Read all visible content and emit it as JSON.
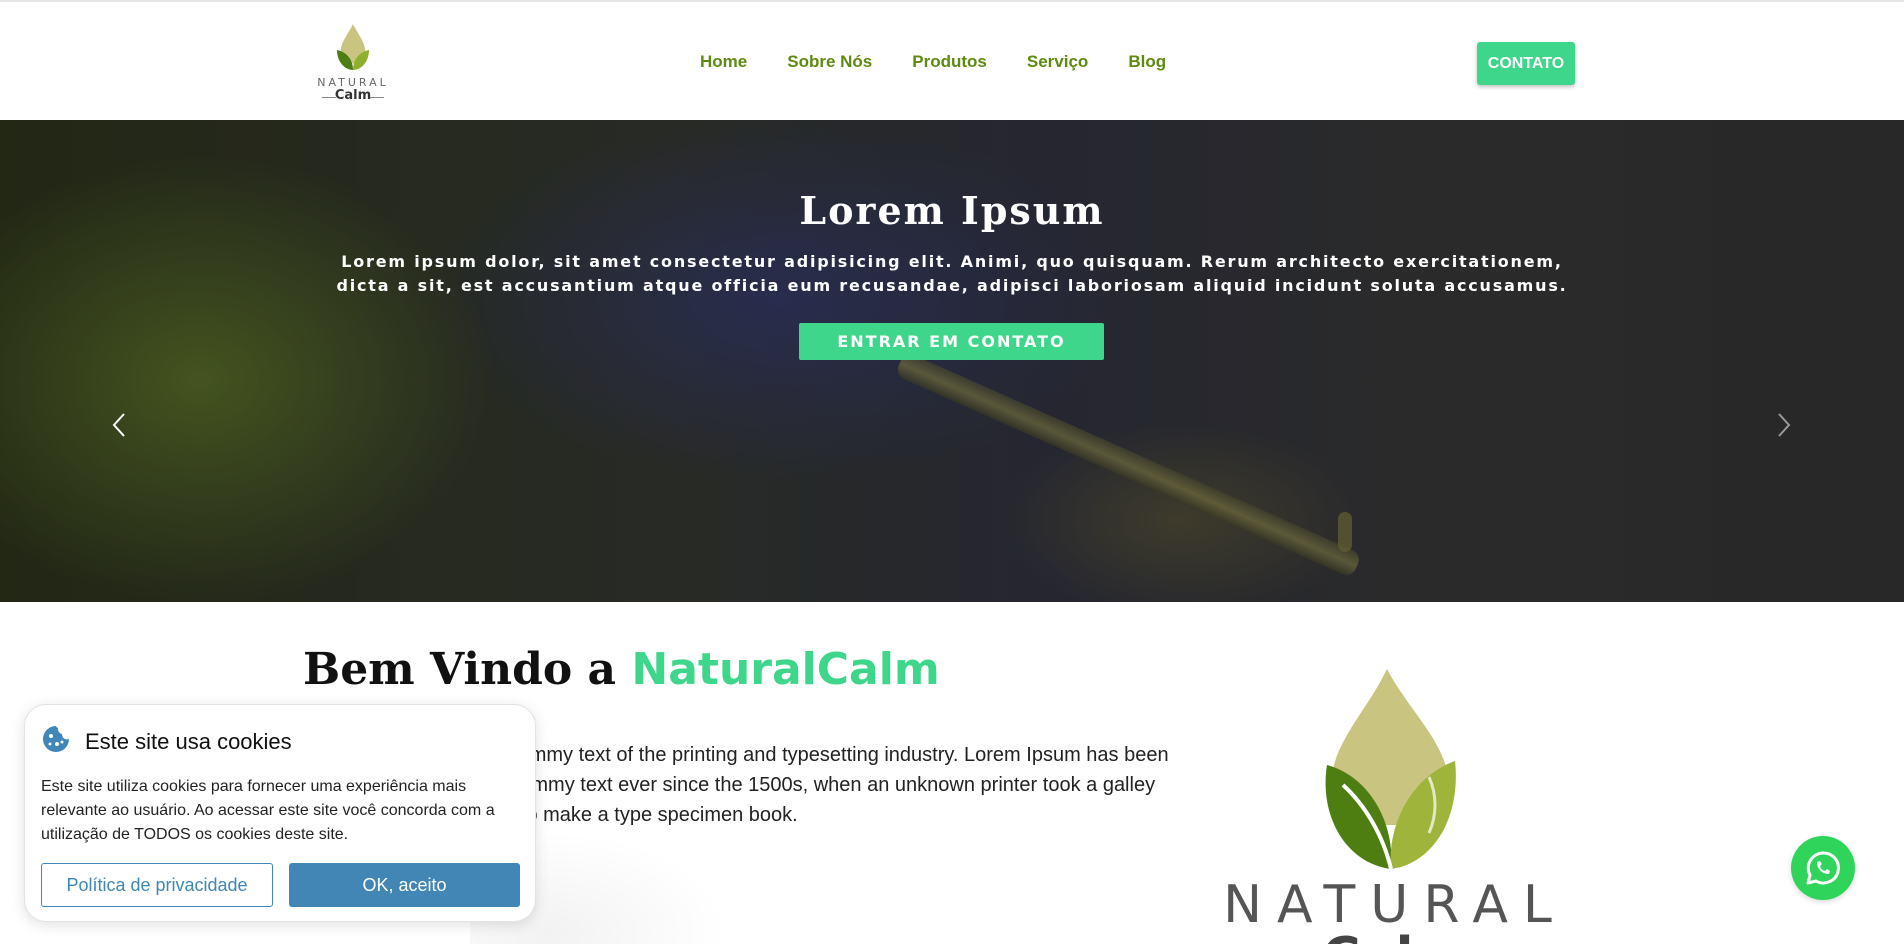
{
  "header": {
    "logo": {
      "word1": "NATURAL",
      "word2": "Calm"
    },
    "nav": [
      {
        "label": "Home"
      },
      {
        "label": "Sobre Nós"
      },
      {
        "label": "Produtos"
      },
      {
        "label": "Serviço"
      },
      {
        "label": "Blog"
      }
    ],
    "contact_button": "CONTATO"
  },
  "hero": {
    "title": "Lorem Ipsum",
    "text_line1": "Lorem ipsum dolor, sit amet consectetur adipisicing elit. Animi, quo quisquam. Rerum architecto exercitationem,",
    "text_line2": "dicta a sit, est accusantium atque officia eum recusandae, adipisci laboriosam aliquid incidunt soluta accusamus.",
    "button": "ENTRAR EM CONTATO",
    "prev_icon": "chevron-left-icon",
    "next_icon": "chevron-right-icon"
  },
  "welcome": {
    "title_prefix": "Bem Vindo a",
    "title_brand": "NaturalCalm",
    "text": "Lorem Ipsum is simply dummy text of the printing and typesetting industry. Lorem Ipsum has been the industry's standard dummy text ever since the 1500s, when an unknown printer took a galley of type and scrambled it to make a type specimen book.",
    "logo_word1": "NATURAL",
    "logo_word2": "Calm"
  },
  "cookie_banner": {
    "icon": "cookie-icon",
    "title": "Este site usa cookies",
    "text": "Este site utiliza cookies para fornecer uma experiência mais relevante ao usuário. Ao acessar este site você concorda com a utilização de TODOS os cookies deste site.",
    "privacy_button": "Política de privacidade",
    "accept_button": "OK, aceito"
  },
  "whatsapp": {
    "icon": "whatsapp-icon"
  },
  "colors": {
    "accent_green": "#3ed68a",
    "nav_green": "#5e8a10",
    "cookie_blue": "#4286b5",
    "whatsapp_green": "#2fd45b"
  }
}
